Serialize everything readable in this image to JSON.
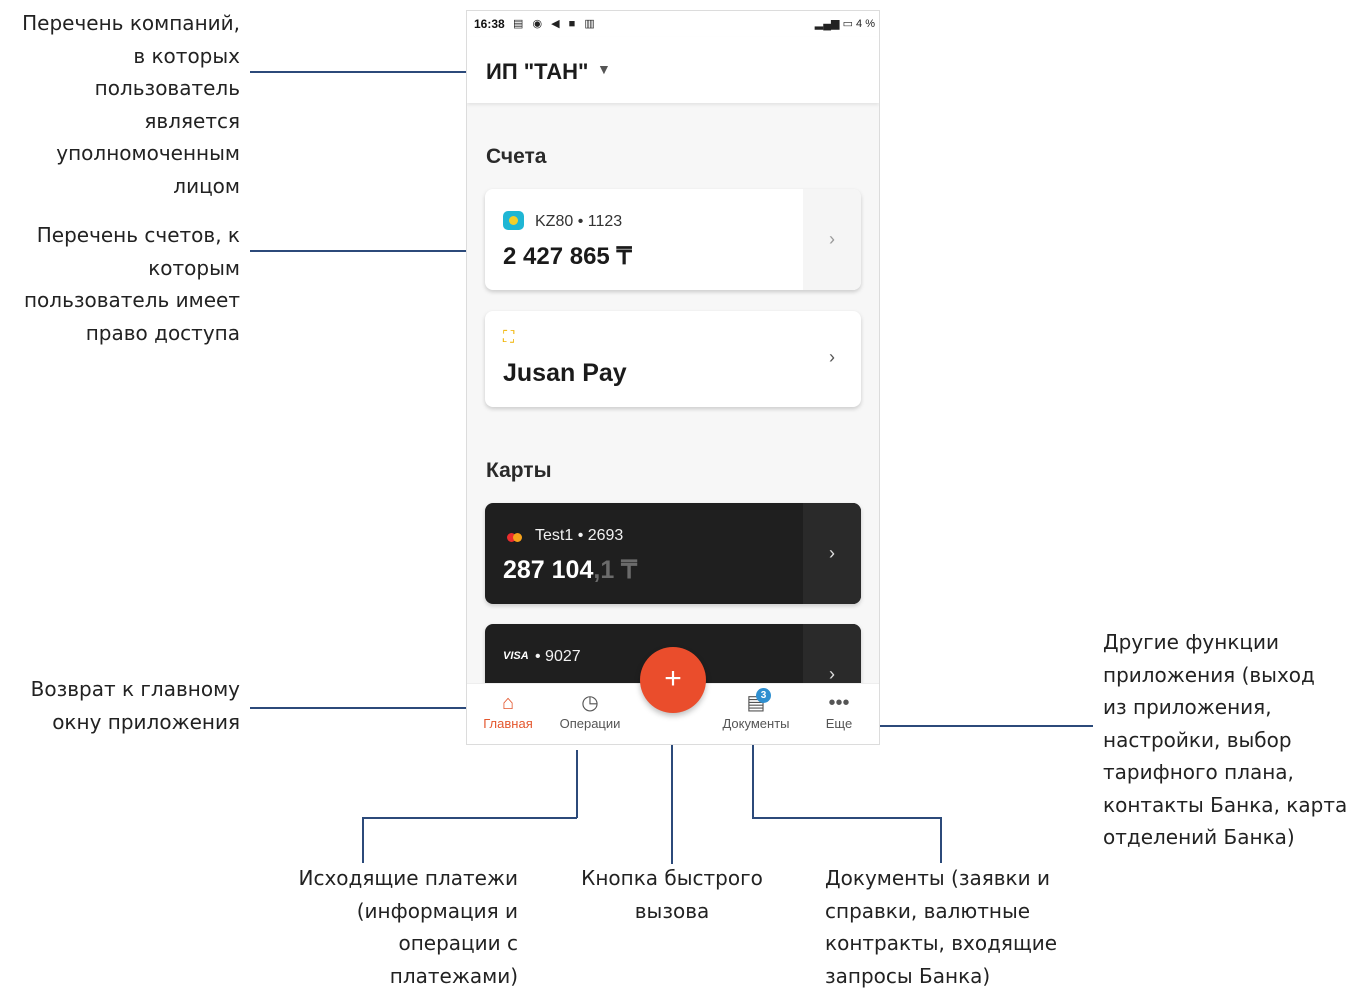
{
  "annotations": {
    "companies": [
      "Перечень компаний,",
      "в которых",
      "пользователь",
      "является",
      "уполномоченным",
      "лицом"
    ],
    "accounts": [
      "Перечень счетов, к",
      "которым",
      "пользователь имеет",
      "право доступа"
    ],
    "home": [
      "Возврат к главному",
      "окну приложения"
    ],
    "more": [
      "Другие функции",
      "приложения (выход",
      "из приложения,",
      "настройки, выбор",
      "тарифного плана,",
      "контакты Банка, карта",
      "отделений Банка)"
    ],
    "operations": [
      "Исходящие платежи",
      "(информация и",
      "операции с",
      "платежами)"
    ],
    "fab": [
      "Кнопка быстрого",
      "вызова"
    ],
    "documents": [
      "Документы (заявки и",
      "справки, валютные",
      "контракты,  входящие",
      "запросы Банка)"
    ]
  },
  "phone": {
    "status_bar": {
      "time": "16:38",
      "battery": "4 %"
    },
    "company": {
      "name": "ИП \"ТАН\""
    },
    "accounts_section": {
      "title": "Счета"
    },
    "account": {
      "label": "KZ80 • 1123",
      "amount": "2 427 865 ₸"
    },
    "jusan_pay": {
      "title": "Jusan Pay"
    },
    "cards_section": {
      "title": "Карты"
    },
    "card1": {
      "label": "Test1 • 2693",
      "amount_main": "287 104",
      "amount_decimal": ",1 ₸"
    },
    "card2": {
      "brand": "VISA",
      "label": "• 9027"
    },
    "nav": {
      "home": "Главная",
      "operations": "Операции",
      "documents": "Документы",
      "documents_badge": "3",
      "more": "Еще"
    },
    "fab_symbol": "+"
  },
  "colors": {
    "accent": "#ea4d2c",
    "annotation_line": "#2c4a7a",
    "badge": "#2f8fd0"
  }
}
